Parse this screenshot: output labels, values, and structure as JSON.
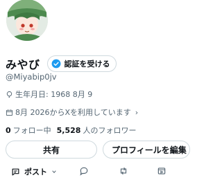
{
  "profile": {
    "display_name": "みやび",
    "verify_label": "認証を受ける",
    "handle": "@Miyabip0jv",
    "birth": "生年月日: 1968 8月 9",
    "joined": "8月 2026からXを利用しています",
    "following_count": "0",
    "following_label": "フォロー中",
    "followers_count": "5,528",
    "followers_label": "人のフォロワー"
  },
  "buttons": {
    "share": "共有",
    "edit_profile": "プロフィールを編集"
  },
  "action_bar": {
    "post_label": "ポスト"
  },
  "colors": {
    "text": "#0f1419",
    "muted": "#536471",
    "border": "#cfd9de",
    "verified": "#1d9bf0"
  },
  "icons": [
    "avatar",
    "verified-badge-icon",
    "balloon-icon",
    "calendar-icon",
    "chevron-right-icon",
    "post-icon",
    "chevron-down-icon",
    "reply-icon",
    "repost-icon",
    "view-icon"
  ]
}
